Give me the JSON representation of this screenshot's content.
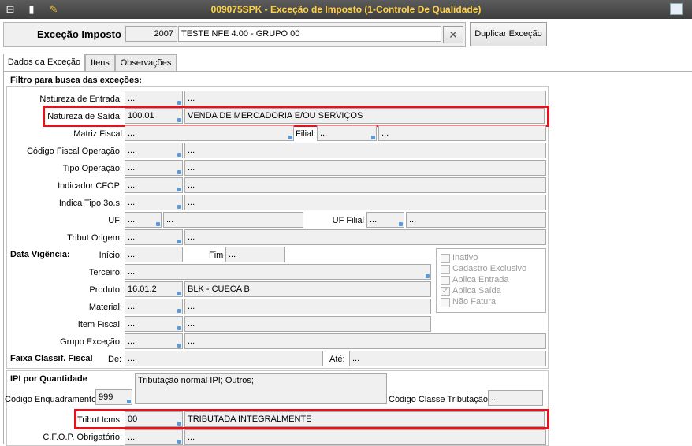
{
  "window": {
    "title": "009075SPK - Exceção de Imposto (1-Controle De Qualidade)"
  },
  "header": {
    "label": "Exceção Imposto",
    "code": "2007",
    "description": "TESTE NFE 4.00 - GRUPO 00",
    "clear_symbol": "✕",
    "duplicate_button": "Duplicar Exceção"
  },
  "tabs": [
    {
      "label": "Dados da Exceção",
      "active": true
    },
    {
      "label": "Itens",
      "active": false
    },
    {
      "label": "Observações",
      "active": false
    }
  ],
  "filter": {
    "heading": "Filtro para busca das exceções:",
    "natureza_entrada": {
      "label": "Natureza de Entrada:",
      "code": "...",
      "desc": "..."
    },
    "natureza_saida": {
      "label": "Natureza de Saída:",
      "code": "100.01",
      "desc": "VENDA DE MERCADORIA E/OU SERVIÇOS"
    },
    "matriz_fiscal": {
      "label": "Matriz Fiscal",
      "code": "...",
      "filial_label": "Filial:",
      "filial_code": "...",
      "filial_desc": "..."
    },
    "codigo_fiscal_operacao": {
      "label": "Código Fiscal Operação:",
      "code": "...",
      "desc": "..."
    },
    "tipo_operacao": {
      "label": "Tipo Operação:",
      "code": "...",
      "desc": "..."
    },
    "indicador_cfop": {
      "label": "Indicador CFOP:",
      "code": "...",
      "desc": "..."
    },
    "indica_tipo": {
      "label": "Indica Tipo 3o.s:",
      "code": "...",
      "desc": "..."
    },
    "uf": {
      "label": "UF:",
      "code": "...",
      "desc": "...",
      "filial_label": "UF Filial",
      "filial_code": "...",
      "filial_desc": "..."
    },
    "tribut_origem": {
      "label": "Tribut Origem:",
      "code": "...",
      "desc": "..."
    },
    "data_vigencia": {
      "label": "Data Vigência:",
      "inicio_label": "Início:",
      "inicio": "...",
      "fim_label": "Fim",
      "fim": "..."
    },
    "terceiro": {
      "label": "Terceiro:",
      "value": "..."
    },
    "produto": {
      "label": "Produto:",
      "code": "16.01.2",
      "desc": "BLK - CUECA B"
    },
    "material": {
      "label": "Material:",
      "code": "...",
      "desc": "..."
    },
    "item_fiscal": {
      "label": "Item Fiscal:",
      "code": "...",
      "desc": "..."
    },
    "grupo_excecao": {
      "label": "Grupo Exceção:",
      "code": "...",
      "desc": "..."
    },
    "faixa": {
      "label": "Faixa Classif. Fiscal",
      "de_label": "De:",
      "de": "...",
      "ate_label": "Até:",
      "ate": "..."
    }
  },
  "checkboxes": [
    {
      "label": "Inativo",
      "checked": false
    },
    {
      "label": "Cadastro Exclusivo",
      "checked": false
    },
    {
      "label": "Aplica Entrada",
      "checked": false
    },
    {
      "label": "Aplica Saída",
      "checked": true
    },
    {
      "label": "Não Fatura",
      "checked": false
    }
  ],
  "ipi": {
    "heading": "IPI por Quantidade",
    "tributacao": "Tributação normal IPI; Outros;",
    "codigo_enquadramento_label": "Código Enquadramento",
    "codigo_enquadramento": "999",
    "codigo_classe_label": "Código Classe Tributação",
    "codigo_classe": "..."
  },
  "icms": {
    "tribut_label": "Tribut Icms:",
    "tribut_code": "00",
    "tribut_desc": "TRIBUTADA INTEGRALMENTE",
    "cfop_label": "C.F.O.P. Obrigatório:",
    "cfop_code": "...",
    "cfop_desc": "..."
  },
  "colors": {
    "title_text": "#ffd24a",
    "highlight": "#e0131f",
    "lookup_corner": "#5a9ad9"
  }
}
